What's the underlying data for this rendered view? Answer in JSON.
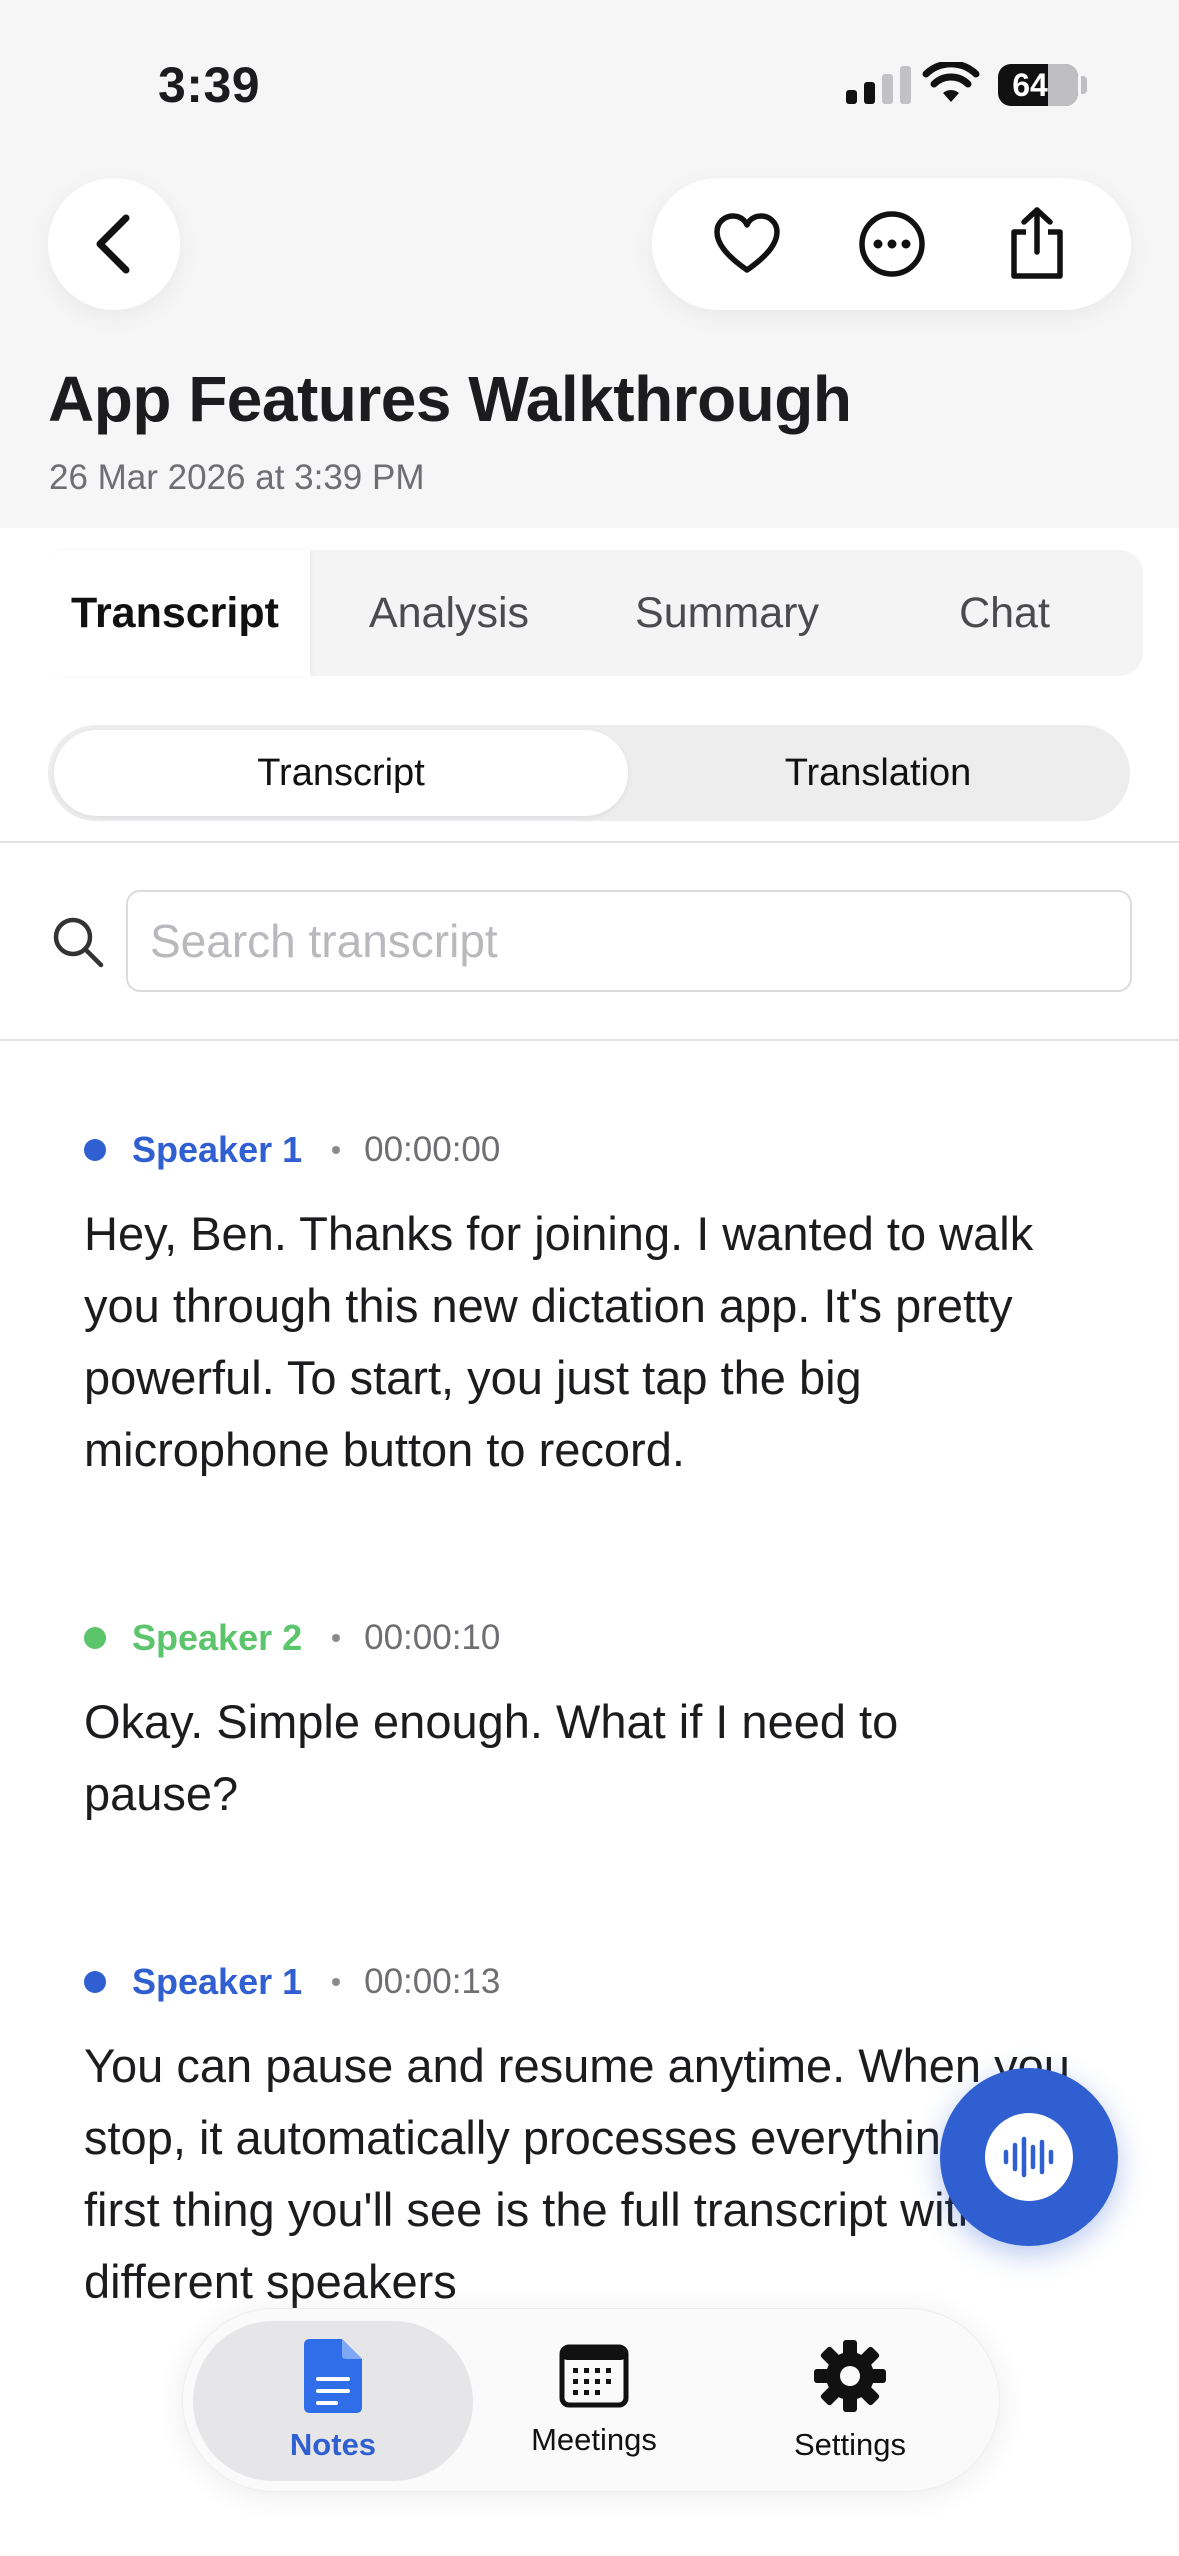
{
  "status_bar": {
    "time": "3:39",
    "battery": "64"
  },
  "header": {
    "title": "App Features Walkthrough",
    "date": "26 Mar 2026 at 3:39 PM"
  },
  "tabs": [
    {
      "label": "Transcript",
      "active": true
    },
    {
      "label": "Analysis",
      "active": false
    },
    {
      "label": "Summary",
      "active": false
    },
    {
      "label": "Chat",
      "active": false
    }
  ],
  "segmented": {
    "selected": "Transcript",
    "other": "Translation"
  },
  "search": {
    "placeholder": "Search transcript"
  },
  "transcript": [
    {
      "speaker": "Speaker 1",
      "color": "#2f5fd0",
      "timestamp": "00:00:00",
      "text": "Hey, Ben. Thanks for joining. I wanted to walk you through this new dictation app. It's pretty powerful. To start, you just tap the big microphone button to record."
    },
    {
      "speaker": "Speaker 2",
      "color": "#5cc46b",
      "timestamp": "00:00:10",
      "text": "Okay. Simple enough. What if I need to pause?"
    },
    {
      "speaker": "Speaker 1",
      "color": "#2f5fd0",
      "timestamp": "00:00:13",
      "text": "You can pause and resume anytime. When you stop, it automatically processes everything. The first thing you'll see is the full transcript with different speakers"
    }
  ],
  "tab_bar": {
    "notes": "Notes",
    "meetings": "Meetings",
    "settings": "Settings"
  },
  "colors": {
    "accent": "#2f5fd0",
    "speaker2": "#5cc46b"
  }
}
